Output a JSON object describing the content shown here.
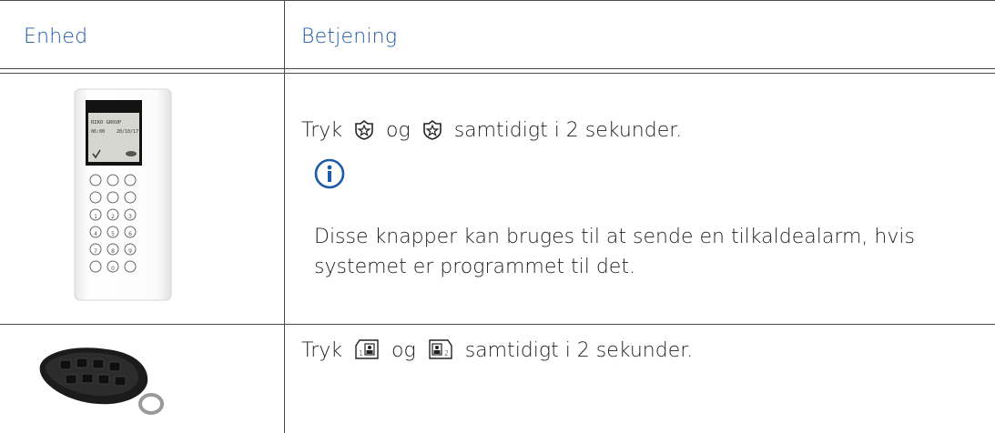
{
  "table": {
    "header": {
      "col1": "Enhed",
      "col2": "Betjening"
    },
    "rows": [
      {
        "device_icon": "wireless-keypad-image",
        "instruction_prefix": "Tryk",
        "instruction_joiner": "og",
        "instruction_suffix": "samtidigt i 2 sekunder.",
        "button_icon_1": "police-panic-button-icon",
        "button_icon_2": "police-panic-button-icon",
        "note_icon": "info-icon",
        "note_text": "Disse knapper kan bruges til at sende en tilkaldealarm, hvis systemet er programmet til det.",
        "keypad_screen": {
          "line1": "RIKO GROUP",
          "line2_left": "06:00",
          "line2_right": "20/10/17"
        }
      },
      {
        "device_icon": "key-fob-remote-image",
        "instruction_prefix": "Tryk",
        "instruction_joiner": "og",
        "instruction_suffix": "samtidigt i 2 sekunder.",
        "button_icon_1": "remote-button-1-icon",
        "button_icon_2": "remote-button-2-icon"
      }
    ]
  },
  "colors": {
    "header_text": "#1f5aa8",
    "rule": "#4a4a4a"
  }
}
